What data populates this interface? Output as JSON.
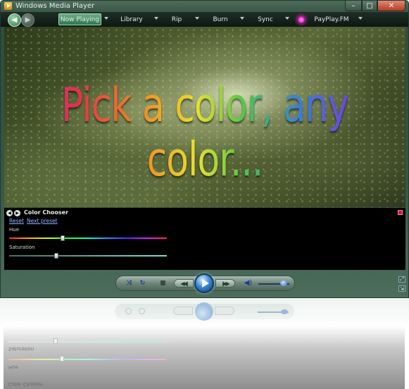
{
  "window": {
    "title": "Windows Media Player"
  },
  "window_controls": {
    "minimize": "–",
    "maximize": "□",
    "close": "✕"
  },
  "nav": {
    "back_icon": "back-arrow-icon",
    "forward_icon": "forward-arrow-icon",
    "tabs": [
      {
        "label": "Now Playing",
        "active": true
      },
      {
        "label": "Library",
        "active": false
      },
      {
        "label": "Rip",
        "active": false
      },
      {
        "label": "Burn",
        "active": false
      },
      {
        "label": "Sync",
        "active": false
      },
      {
        "label": "PayPlay.FM",
        "active": false
      }
    ]
  },
  "video": {
    "overlay_text": "Pick a color, any color..."
  },
  "enhancement": {
    "title": "Color Chooser",
    "links": {
      "reset": "Reset",
      "next_preset": "Next preset"
    },
    "hue": {
      "label": "Hue",
      "value_fraction": 0.34
    },
    "saturation": {
      "label": "Saturation",
      "value_fraction": 0.3
    }
  },
  "transport": {
    "shuffle_icon": "shuffle-icon",
    "repeat_icon": "repeat-icon",
    "stop_icon": "stop-icon",
    "previous_icon": "previous-icon",
    "play_icon": "play-icon",
    "next_icon": "next-icon",
    "mute_icon": "speaker-icon",
    "volume_fraction": 0.82
  },
  "colors": {
    "frame": "#365646",
    "active_tab": "#4f9670",
    "close_button": "#c8553f",
    "link": "#8fb0ff"
  }
}
